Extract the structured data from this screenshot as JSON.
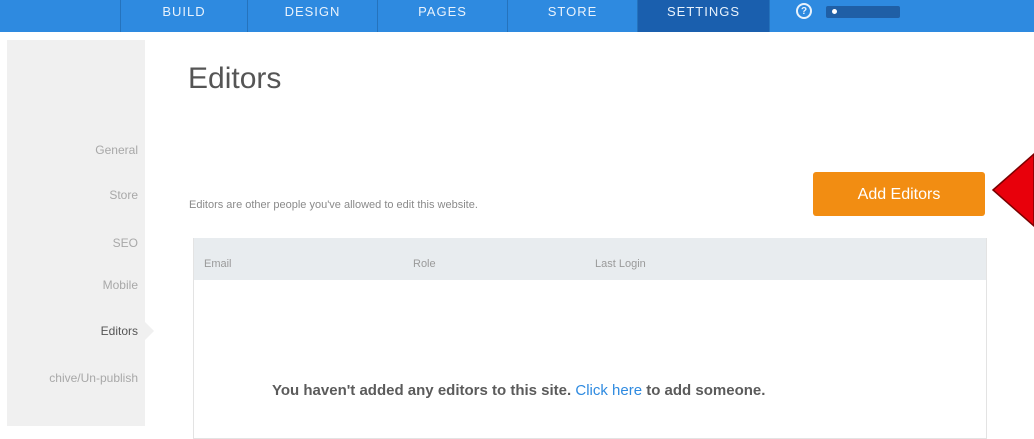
{
  "nav": {
    "items": [
      {
        "label": "BUILD"
      },
      {
        "label": "DESIGN"
      },
      {
        "label": "PAGES"
      },
      {
        "label": "STORE"
      },
      {
        "label": "SETTINGS"
      }
    ],
    "active": "SETTINGS",
    "help_glyph": "?"
  },
  "sidebar": {
    "items": [
      {
        "label": "General"
      },
      {
        "label": "Store"
      },
      {
        "label": "SEO"
      },
      {
        "label": "Mobile"
      },
      {
        "label": "Editors"
      },
      {
        "label": "chive/Un-publish"
      }
    ],
    "active": "Editors"
  },
  "page": {
    "title": "Editors",
    "description": "Editors are other people you've allowed to edit this website.",
    "add_button_label": "Add Editors"
  },
  "table": {
    "columns": [
      "Email",
      "Role",
      "Last Login"
    ],
    "empty_text": "You haven't added any editors to this site.",
    "empty_link": "Click here",
    "empty_suffix": "to add someone."
  },
  "colors": {
    "topbar": "#2e8ae0",
    "accent_button": "#f28d12",
    "annotation_arrow": "#e8000b"
  }
}
